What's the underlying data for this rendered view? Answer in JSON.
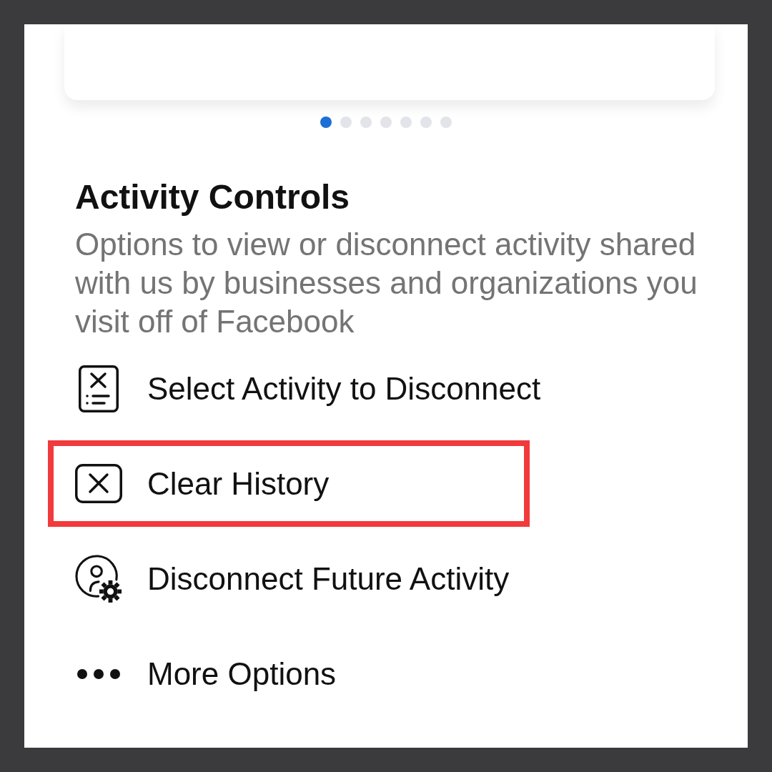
{
  "carousel": {
    "pages": [
      {
        "selected": true
      },
      {
        "selected": false
      },
      {
        "selected": false
      },
      {
        "selected": false
      },
      {
        "selected": false
      },
      {
        "selected": false
      },
      {
        "selected": false
      }
    ]
  },
  "section": {
    "title": "Activity Controls",
    "description": "Options to view or disconnect activity shared with us by businesses and organizations you visit off of Facebook"
  },
  "items": [
    {
      "kind": "select",
      "label": "Select Activity to Disconnect",
      "highlighted": false
    },
    {
      "kind": "clear",
      "label": "Clear History",
      "highlighted": true
    },
    {
      "kind": "disconnect",
      "label": "Disconnect Future Activity",
      "highlighted": false
    },
    {
      "kind": "more",
      "label": "More Options",
      "highlighted": false
    }
  ]
}
